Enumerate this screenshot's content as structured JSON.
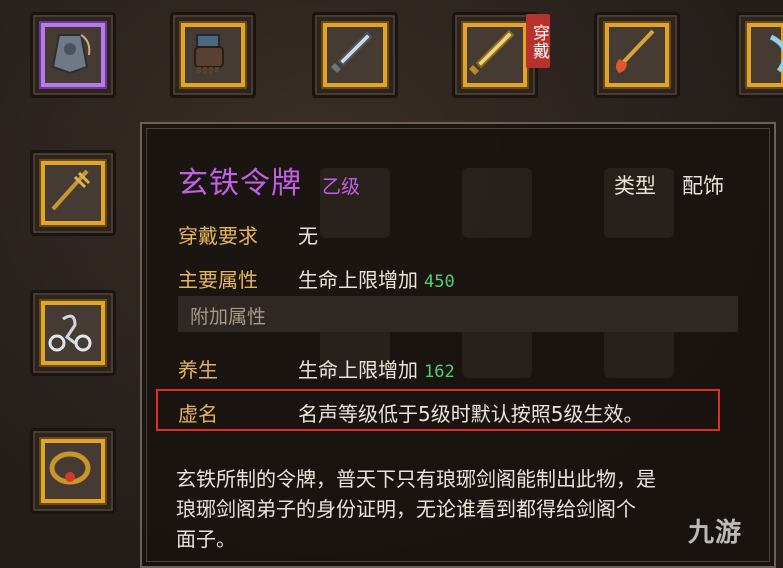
{
  "equip_tag": "穿戴",
  "item": {
    "name": "玄铁令牌",
    "grade": "乙级",
    "type_label": "类型",
    "type_value": "配饰"
  },
  "rows": [
    {
      "key": "穿戴要求",
      "value": "无"
    },
    {
      "key": "主要属性",
      "value": "生命上限增加",
      "number": "450"
    }
  ],
  "extra_header": "附加属性",
  "extra_rows": [
    {
      "key": "养生",
      "value": "生命上限增加",
      "number": "162"
    },
    {
      "key": "虚名",
      "value": "名声等级低于5级时默认按照5级生效。"
    }
  ],
  "description_lines": [
    "玄铁所制的令牌，普天下只有琅琊剑阁能制出此物，是",
    "琅琊剑阁弟子的身份证明，无论谁看到都得给剑阁个",
    "面子。"
  ],
  "watermark": "九游",
  "colors": {
    "rarity_purple": "#c35fe6",
    "gold_frame": "#e2a52b",
    "highlight_red": "#e12b25",
    "value_green": "#4fd06b"
  }
}
